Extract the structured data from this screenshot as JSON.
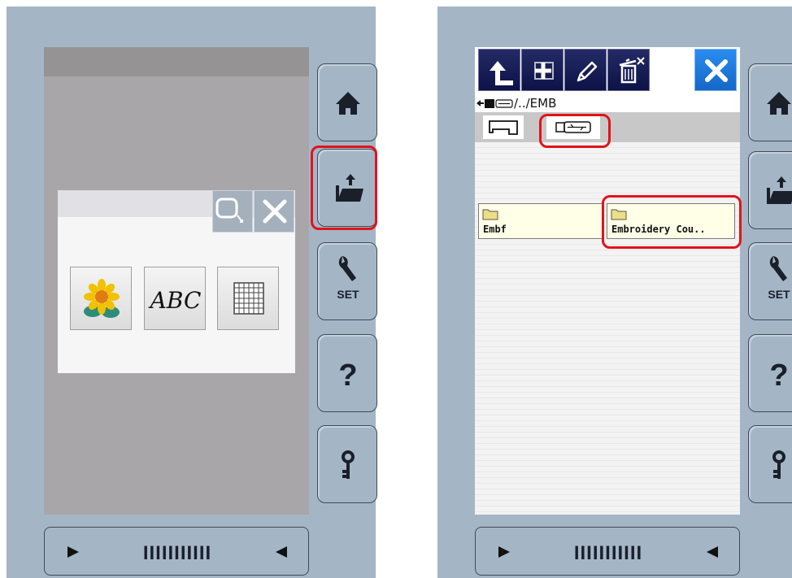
{
  "left_screen": {
    "dialog": {
      "hoop_icon": "hoop-select-icon",
      "close_icon": "close-icon",
      "pattern_buttons": [
        {
          "icon": "embroidery-pattern-icon"
        },
        {
          "icon": "character-pattern-icon",
          "label": "ABC"
        },
        {
          "icon": "frame-pattern-icon"
        }
      ]
    }
  },
  "right_screen": {
    "toolbar": [
      {
        "icon": "back-arrow-icon"
      },
      {
        "icon": "new-folder-icon"
      },
      {
        "icon": "rename-pencil-icon"
      },
      {
        "icon": "delete-trash-icon"
      },
      {
        "icon": "close-icon"
      }
    ],
    "path": "/../EMB",
    "media": [
      {
        "icon": "machine-memory-icon"
      },
      {
        "icon": "usb-media-icon",
        "selected": true
      }
    ],
    "folders": [
      {
        "name": "Embf"
      },
      {
        "name": "Embroidery Cou.."
      }
    ]
  },
  "side_buttons": [
    {
      "icon": "home-icon"
    },
    {
      "icon": "open-folder-icon"
    },
    {
      "icon": "settings-wrench-icon",
      "label": "SET"
    },
    {
      "icon": "help-question-icon"
    },
    {
      "icon": "lock-key-icon"
    }
  ],
  "scrollbar": {
    "left_icon": "left-arrow-icon",
    "right_icon": "right-arrow-icon",
    "ticks": "IIIIIIIIIII"
  },
  "colors": {
    "highlight": "#e2131a",
    "panel": "#a4b6c6",
    "toolbar_button": "#141a52",
    "close_button": "#1a7ae0",
    "folder_fill": "#ede084"
  }
}
